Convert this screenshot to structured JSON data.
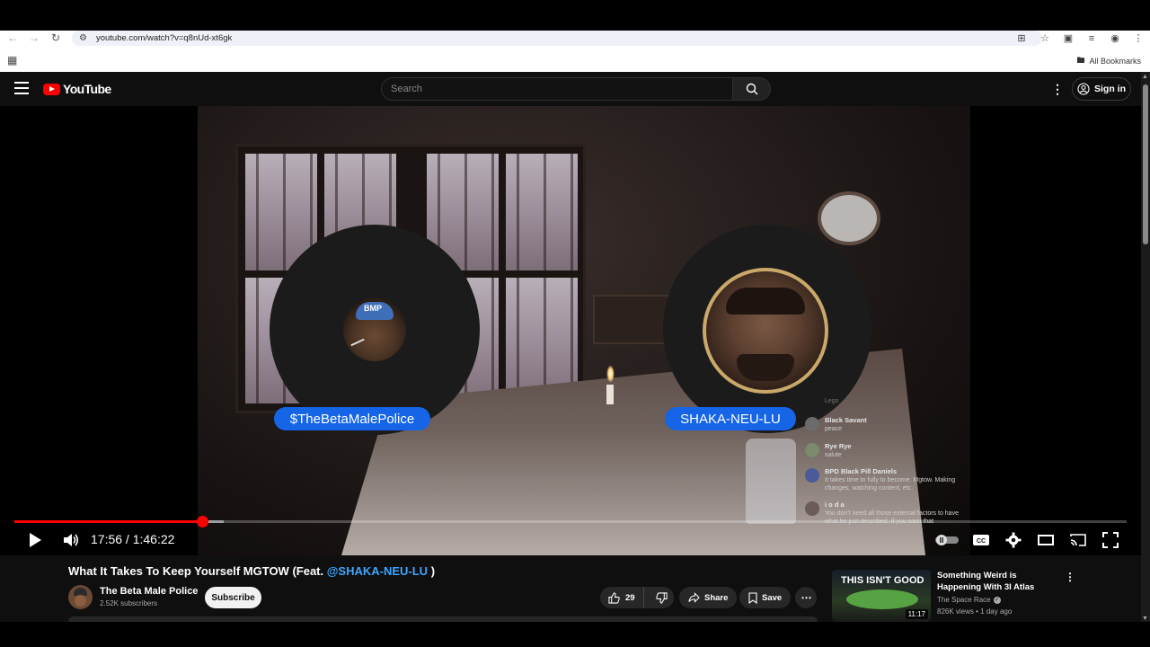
{
  "browser": {
    "url": "youtube.com/watch?v=q8nUd-xt6gk",
    "bookmarks_label": "All Bookmarks"
  },
  "header": {
    "logo_text": "YouTube",
    "search_placeholder": "Search",
    "signin_label": "Sign in"
  },
  "video": {
    "left_speaker": "$TheBetaMalePolice",
    "right_speaker": "SHAKA-NEU-LU",
    "chat_faded": "Lego",
    "chat": [
      {
        "name": "Black Savant",
        "message": "peace"
      },
      {
        "name": "Rye Rye",
        "message": "salute"
      },
      {
        "name": "BPD Black Pill Daniels",
        "message": "It takes time to fully to become. Mgtow. Making changes, watching content, etc."
      },
      {
        "name": "i o d a",
        "message": "You don't need all those external factors to have what he just described. If you want that"
      }
    ],
    "current_time": "17:56",
    "duration": "1:46:22",
    "time_display": "17:56 / 1:46:22",
    "played_fraction": 0.1688,
    "buffered_fraction": 0.188
  },
  "info": {
    "title_prefix": "What It Takes To Keep Yourself MGTOW (Feat. ",
    "title_mention": "@SHAKA-NEU-LU",
    "title_suffix": " )",
    "channel_name": "The Beta Male Police",
    "subscribers": "2.52K subscribers",
    "subscribe_label": "Subscribe",
    "likes": "29",
    "share_label": "Share",
    "save_label": "Save"
  },
  "recommendation": {
    "thumb_text": "THIS ISN'T GOOD",
    "duration": "11:17",
    "title": "Something Weird is Happening With 3I Atlas",
    "channel": "The Space Race",
    "meta": "826K views • 1 day ago"
  },
  "colors": {
    "accent_red": "#ff0000",
    "pill_blue": "#1565e6",
    "mention_blue": "#3ea6ff"
  }
}
